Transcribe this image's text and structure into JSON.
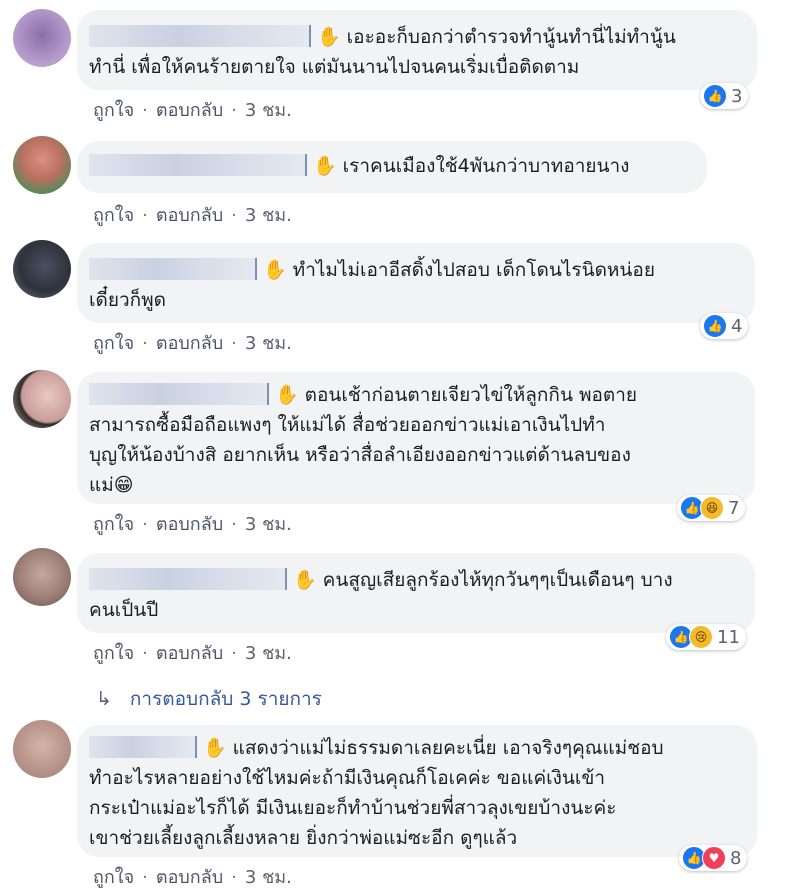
{
  "comments": [
    {
      "lines": [
        "เอะอะก็บอกว่าตำรวจทำนู้นทำนี่ไม่ทำนู้น",
        "ทำนี่ เพื่อให้คนร้ายตายใจ แต่มันนานไปจนคนเริ่มเบื่อติดตาม"
      ],
      "like": "ถูกใจ",
      "reply": "ตอบกลับ",
      "time": "3 ชม.",
      "reactions": [
        "like"
      ],
      "count": "3"
    },
    {
      "lines": [
        "เราคนเมืองใช้4พันกว่าบาทอายนาง"
      ],
      "like": "ถูกใจ",
      "reply": "ตอบกลับ",
      "time": "3 ชม.",
      "reactions": [],
      "count": ""
    },
    {
      "lines": [
        "ทำไมไม่เอาอีสดิ้งไปสอบ เด็กโดนไรนิดหน่อย",
        "เดี๋ยวก็พูด"
      ],
      "like": "ถูกใจ",
      "reply": "ตอบกลับ",
      "time": "3 ชม.",
      "reactions": [
        "like"
      ],
      "count": "4"
    },
    {
      "lines": [
        "ตอนเช้าก่อนตายเจียวไข่ให้ลูกกิน พอตาย",
        "สามารถซื้อมือถือแพงๆ ให้แม่ได้ สื่อช่วยออกข่าวแม่เอาเงินไปทำ",
        "บุญให้น้องบ้างสิ อยากเห็น หรือว่าสื่อลำเอียงออกข่าวแต่ด้านลบของ",
        "แม่😁"
      ],
      "like": "ถูกใจ",
      "reply": "ตอบกลับ",
      "time": "3 ชม.",
      "reactions": [
        "like",
        "haha"
      ],
      "count": "7"
    },
    {
      "lines": [
        "คนสูญเสียลูกร้องไห้ทุกวันๆๆเป็นเดือนๆ บาง",
        "คนเป็นปี"
      ],
      "like": "ถูกใจ",
      "reply": "ตอบกลับ",
      "time": "3 ชม.",
      "reactions": [
        "like",
        "sad"
      ],
      "count": "11"
    },
    {
      "lines": [
        "แสดงว่าแม่ไม่ธรรมดาเลยคะเนี่ย เอาจริงๆคุณแม่ชอบ",
        "ทำอะไรหลายอย่างใช้ไหมค่ะถ้ามีเงินคุณก็โอเคค่ะ ขอแค่เงินเข้า",
        "กระเป๋าแม่อะไรก็ได้ มีเงินเยอะก็ทำบ้านช่วยพี่สาวลุงเขยบ้างนะค่ะ",
        "เขาช่วยเลี้ยงลูกเลี้ยงหลาย ยิ่งกว่าพ่อแม่ซะอีก ดูๆแล้ว"
      ],
      "like": "ถูกใจ",
      "reply": "ตอบกลับ",
      "time": "3 ชม.",
      "reactions": [
        "like",
        "love"
      ],
      "count": "8"
    }
  ],
  "replies_link": "การตอบกลับ 3 รายการ",
  "icons": {
    "like": "thumbs-up-icon",
    "haha": "laughing-face-icon",
    "sad": "crying-face-icon",
    "love": "heart-icon",
    "wave": "waving-hand-icon",
    "reply_arrow": "reply-arrow-icon"
  },
  "colors": {
    "bubble": "#f2f3f5",
    "link": "#365899",
    "like": "#1877f2"
  }
}
